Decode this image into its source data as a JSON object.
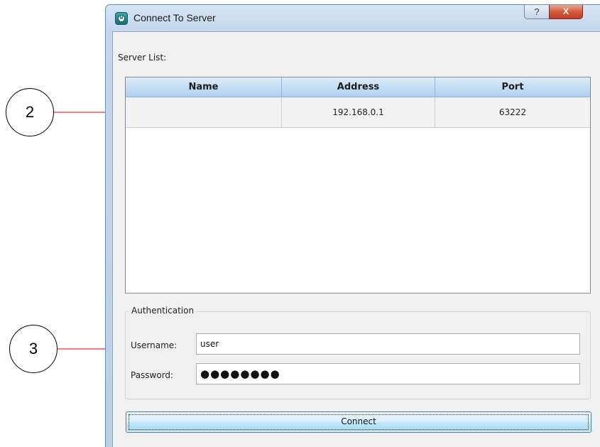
{
  "window": {
    "title": "Connect To Server",
    "app_icon": "app-logo-icon",
    "help_glyph": "?",
    "close_glyph": "X"
  },
  "server_list": {
    "label": "Server List:",
    "columns": [
      "Name",
      "Address",
      "Port"
    ],
    "rows": [
      {
        "name": "",
        "address": "192.168.0.1",
        "port": "63222"
      }
    ]
  },
  "authentication": {
    "title": "Authentication",
    "username_label": "Username:",
    "username_value": "user",
    "password_label": "Password:",
    "password_mask": "●●●●●●●●"
  },
  "connect_label": "Connect",
  "callouts": [
    "2",
    "3"
  ],
  "colors": {
    "callout_arrow": "#e00000",
    "header_accent": "#aed0ee",
    "close_button": "#c23d1d"
  }
}
